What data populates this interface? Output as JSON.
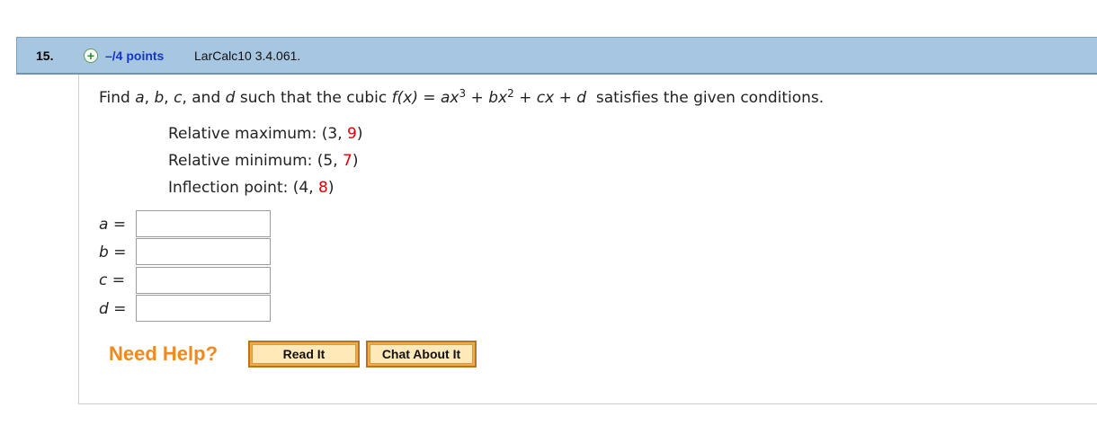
{
  "question": {
    "number": "15.",
    "points": "–/4 points",
    "source": "LarCalc10 3.4.061."
  },
  "prompt": {
    "find": "Find",
    "a": "a",
    "comma1": ",",
    "b": "b",
    "comma2": ",",
    "c": "c",
    "and_text": ", and",
    "d": "d",
    "such": "such that the cubic",
    "fx": "f(x)",
    "eq": "=",
    "ax": "ax",
    "exp3": "3",
    "plus1": "+",
    "bx": "bx",
    "exp2": "2",
    "plus2": "+",
    "cx": "cx",
    "plus3": "+",
    "dd": "d",
    "tail": "satisfies the given conditions."
  },
  "conditions": [
    {
      "label": "Relative maximum: (3,",
      "value": "9",
      "close": ")"
    },
    {
      "label": "Relative minimum: (5,",
      "value": "7",
      "close": ")"
    },
    {
      "label": "Inflection point: (4,",
      "value": "8",
      "close": ")"
    }
  ],
  "answers": [
    {
      "var": "a",
      "eq": "=",
      "value": ""
    },
    {
      "var": "b",
      "eq": "=",
      "value": ""
    },
    {
      "var": "c",
      "eq": "=",
      "value": ""
    },
    {
      "var": "d",
      "eq": "=",
      "value": ""
    }
  ],
  "help": {
    "label": "Need Help?",
    "read_it": "Read It",
    "chat": "Chat About It"
  },
  "colors": {
    "header_bg": "#a7c6e1",
    "points_blue": "#1535c8",
    "highlight_red": "#e00000",
    "help_orange": "#f08a1c"
  },
  "icons": {
    "expand": "plus-circle-icon"
  }
}
